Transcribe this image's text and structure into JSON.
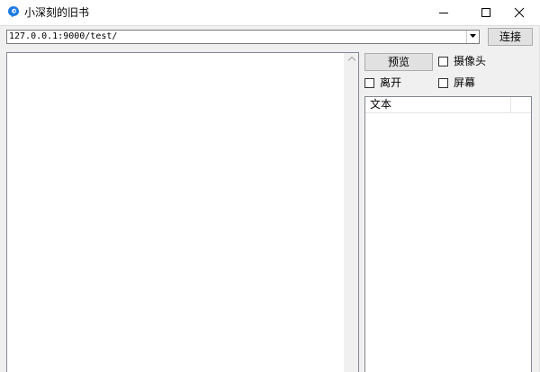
{
  "window": {
    "title": "小深刻的旧书",
    "icon": "app-logo-icon",
    "controls": [
      "minimize-icon",
      "maximize-icon",
      "close-icon"
    ]
  },
  "toolbar": {
    "url_value": "127.0.0.1:9000/test/",
    "connect_label": "连接"
  },
  "side_panel": {
    "preview_label": "预览",
    "camera_label": "摄像头",
    "leave_label": "离开",
    "screen_label": "屏幕",
    "list_columns": [
      "文本",
      ""
    ]
  },
  "colors": {
    "icon_blue": "#1e7be0",
    "button_face": "#e1e1e1",
    "window_bg": "#f0f0f0"
  }
}
